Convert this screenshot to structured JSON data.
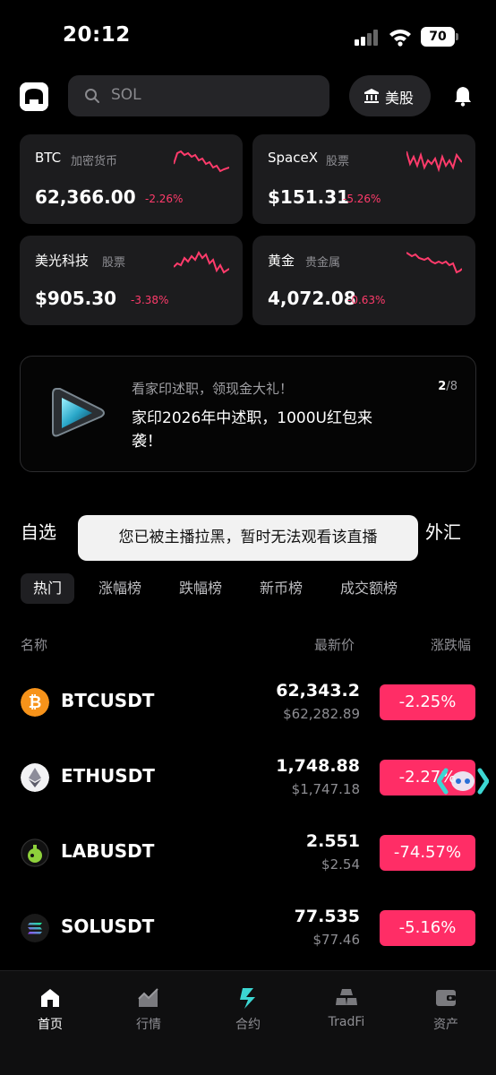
{
  "status": {
    "time": "20:12",
    "battery": "70"
  },
  "header": {
    "search_placeholder": "SOL",
    "market_button": "美股"
  },
  "cards": [
    {
      "name": "BTC",
      "category": "加密货币",
      "price": "62,366.00",
      "change": "-2.26%"
    },
    {
      "name": "SpaceX",
      "category": "股票",
      "price": "$151.31",
      "change": "-5.26%"
    },
    {
      "name": "美光科技",
      "category": "股票",
      "price": "$905.30",
      "change": "-3.38%"
    },
    {
      "name": "黄金",
      "category": "贵金属",
      "price": "4,072.08",
      "change": "-0.63%"
    }
  ],
  "banner": {
    "subtitle": "看家印述职，领现金大礼！",
    "title": "家印2026年中述职，1000U红包来袭！",
    "page_current": "2",
    "page_total": "/8"
  },
  "main_tabs": {
    "left": "自选",
    "right": "外汇"
  },
  "toast": "您已被主播拉黑，暂时无法观看该直播",
  "sub_tabs": [
    "热门",
    "涨幅榜",
    "跌幅榜",
    "新币榜",
    "成交额榜"
  ],
  "list_header": {
    "name": "名称",
    "price": "最新价",
    "change": "涨跌幅"
  },
  "rows": [
    {
      "symbol": "BTCUSDT",
      "price": "62,343.2",
      "usd": "$62,282.89",
      "change": "-2.25%"
    },
    {
      "symbol": "ETHUSDT",
      "price": "1,748.88",
      "usd": "$1,747.18",
      "change": "-2.27%"
    },
    {
      "symbol": "LABUSDT",
      "price": "2.551",
      "usd": "$2.54",
      "change": "-74.57%"
    },
    {
      "symbol": "SOLUSDT",
      "price": "77.535",
      "usd": "$77.46",
      "change": "-5.16%"
    }
  ],
  "nav": [
    "首页",
    "行情",
    "合约",
    "TradFi",
    "资产"
  ],
  "colors": {
    "down": "#ff2d66",
    "accent": "#3cd6d2",
    "card_bg": "#1c1c1e"
  }
}
